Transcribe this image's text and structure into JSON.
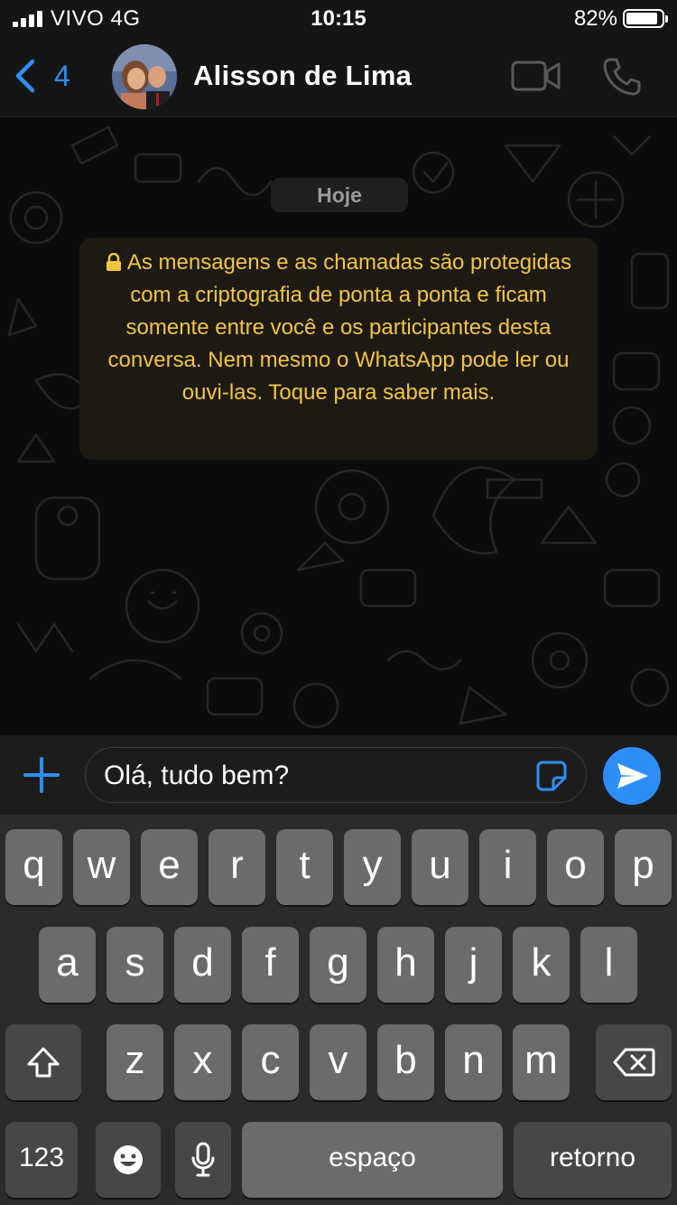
{
  "status_bar": {
    "carrier": "VIVO   4G",
    "time": "10:15",
    "battery": "82%"
  },
  "header": {
    "back_count": "4",
    "contact_name": "Alisson de Lima"
  },
  "chat": {
    "date_chip": "Hoje",
    "encryption_notice": "As mensagens e as chamadas são protegidas com a criptografia de ponta a ponta e ficam somente entre você e os participantes desta conversa. Nem mesmo o WhatsApp pode ler ou ouvi-las. Toque para saber mais."
  },
  "composer": {
    "message_text": "Olá, tudo bem?"
  },
  "keyboard": {
    "row1": [
      "q",
      "w",
      "e",
      "r",
      "t",
      "y",
      "u",
      "i",
      "o",
      "p"
    ],
    "row2": [
      "a",
      "s",
      "d",
      "f",
      "g",
      "h",
      "j",
      "k",
      "l"
    ],
    "row3": [
      "z",
      "x",
      "c",
      "v",
      "b",
      "n",
      "m"
    ],
    "numbers_label": "123",
    "space_label": "espaço",
    "return_label": "retorno"
  },
  "colors": {
    "accent": "#2e8ef7",
    "notice_text": "#f4c542",
    "header_bg": "#151515",
    "key_bg": "#6b6b6b",
    "key_dark_bg": "#474747"
  }
}
